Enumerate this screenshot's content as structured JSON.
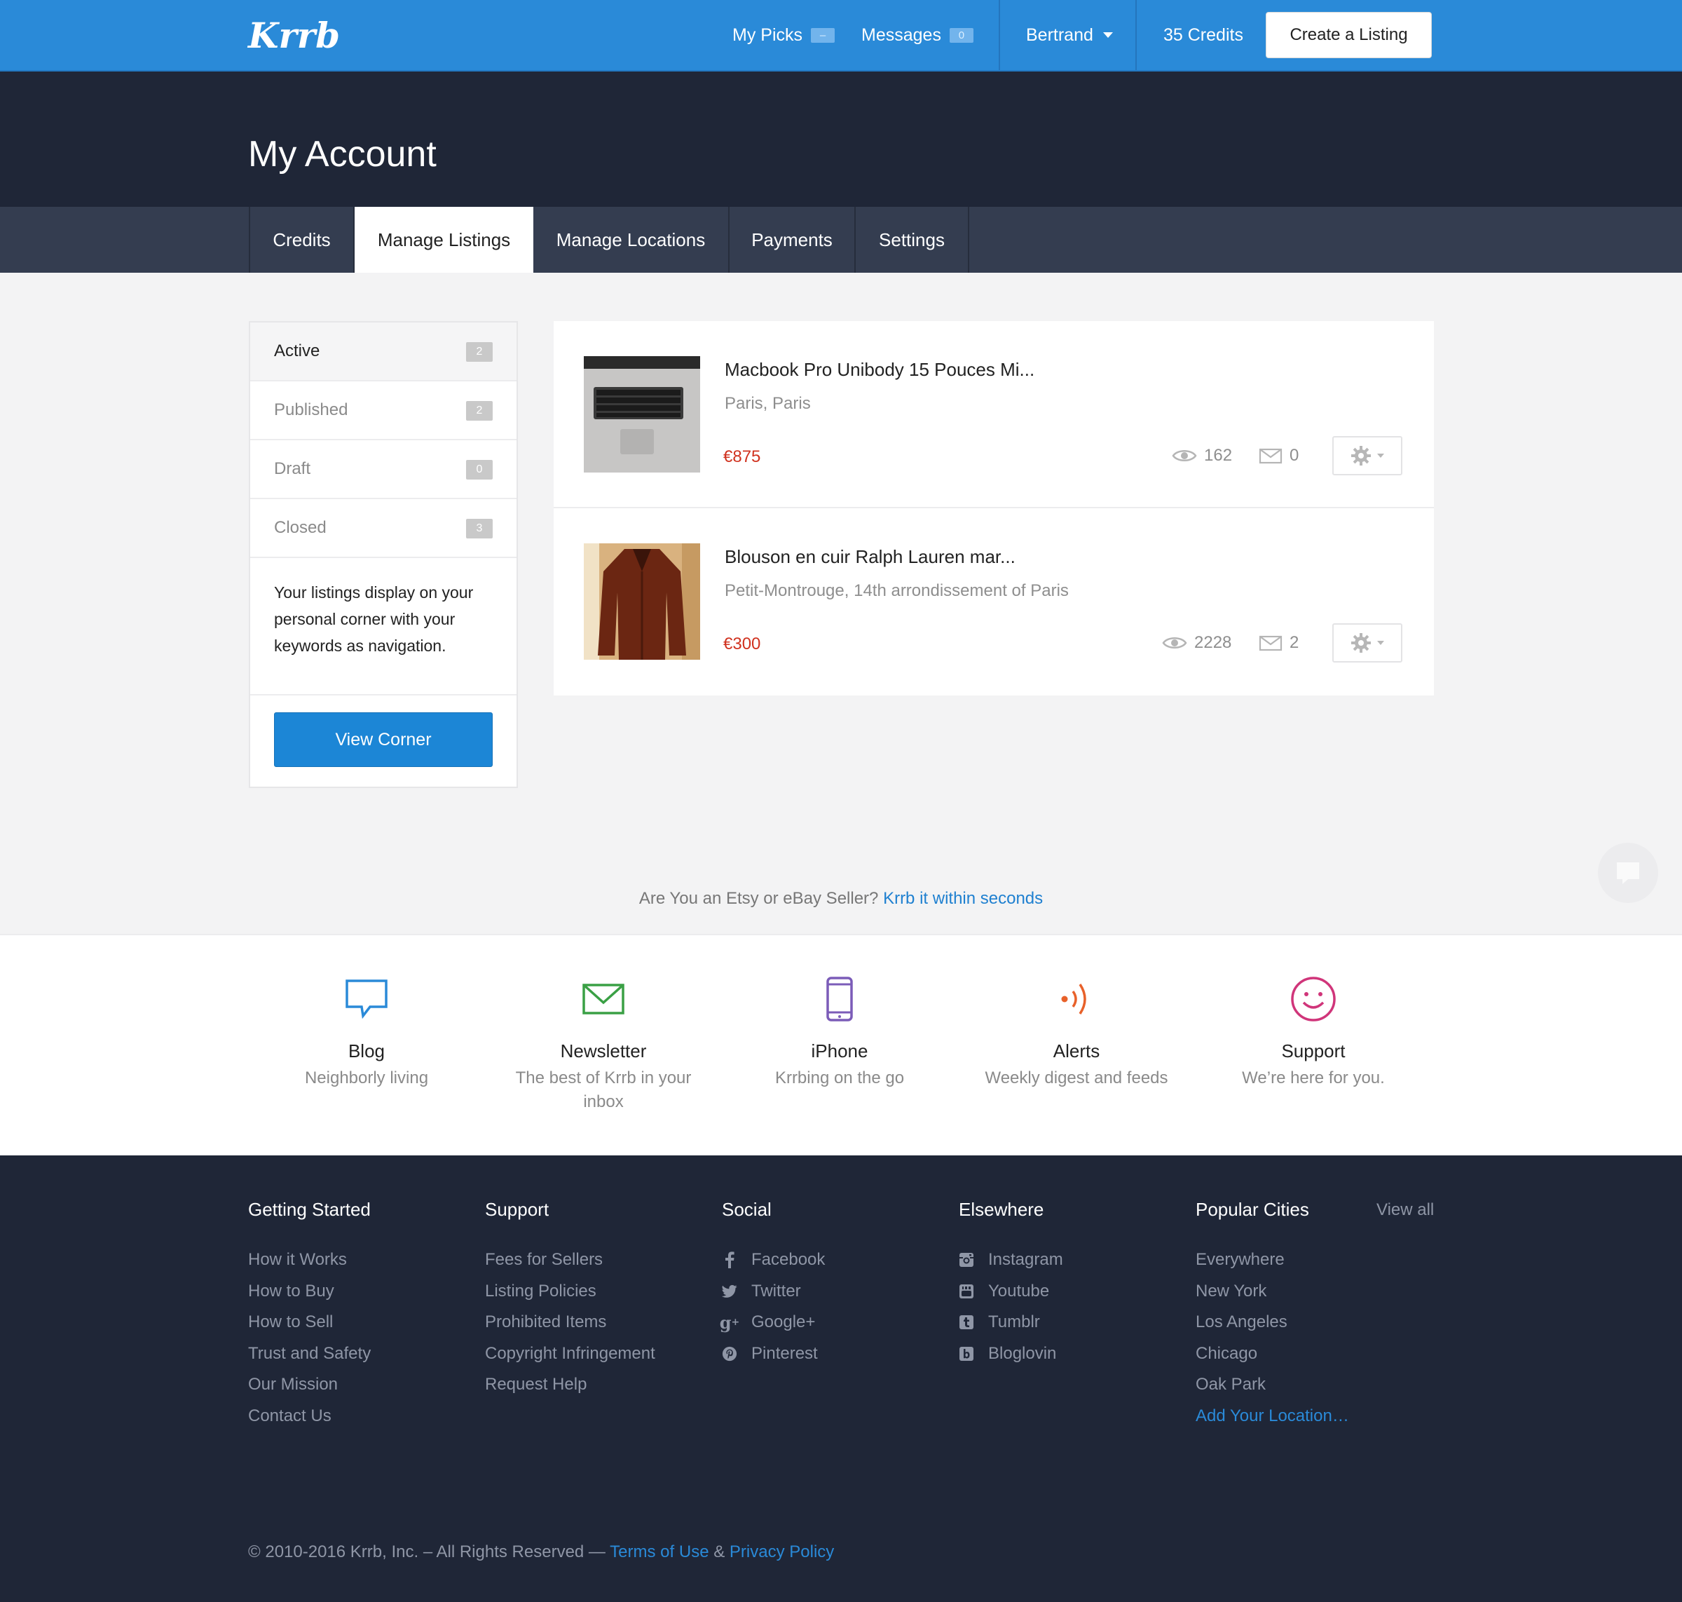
{
  "brand": {
    "logo_text": "Krrb"
  },
  "topnav": {
    "my_picks": "My Picks",
    "my_picks_badge": "–",
    "messages": "Messages",
    "messages_badge": "0",
    "user": "Bertrand",
    "credits": "35 Credits",
    "create_listing": "Create a Listing"
  },
  "page": {
    "title": "My Account"
  },
  "tabs": [
    {
      "label": "Credits"
    },
    {
      "label": "Manage Listings",
      "active": true
    },
    {
      "label": "Manage Locations"
    },
    {
      "label": "Payments"
    },
    {
      "label": "Settings"
    }
  ],
  "sidebar": {
    "items": [
      {
        "label": "Active",
        "count": "2",
        "active": true
      },
      {
        "label": "Published",
        "count": "2"
      },
      {
        "label": "Draft",
        "count": "0"
      },
      {
        "label": "Closed",
        "count": "3"
      }
    ],
    "description": "Your listings display on your personal corner with your keywords as navigation.",
    "view_corner": "View Corner"
  },
  "listings": [
    {
      "title": "Macbook Pro Unibody 15 Pouces Mi...",
      "location": "Paris, Paris",
      "price": "€875",
      "views": "162",
      "messages": "0"
    },
    {
      "title": "Blouson en cuir Ralph Lauren mar...",
      "location": "Petit-Montrouge, 14th arrondissement of Paris",
      "price": "€300",
      "views": "2228",
      "messages": "2"
    }
  ],
  "promo": {
    "text": "Are You an Etsy or eBay Seller?",
    "link": "Krrb it within seconds"
  },
  "features": [
    {
      "title": "Blog",
      "sub": "Neighborly living",
      "icon": "speech-bubble-icon",
      "color": "#2a8ad8"
    },
    {
      "title": "Newsletter",
      "sub": "The best of Krrb in your inbox",
      "icon": "envelope-icon",
      "color": "#3aa045"
    },
    {
      "title": "iPhone",
      "sub": "Krrbing on the go",
      "icon": "phone-icon",
      "color": "#7b5cb8"
    },
    {
      "title": "Alerts",
      "sub": "Weekly digest and feeds",
      "icon": "signal-icon",
      "color": "#e8612a"
    },
    {
      "title": "Support",
      "sub": "We’re here for you.",
      "icon": "smiley-icon",
      "color": "#d0357a"
    }
  ],
  "footer": {
    "getting_started": {
      "heading": "Getting Started",
      "links": [
        "How it Works",
        "How to Buy",
        "How to Sell",
        "Trust and Safety",
        "Our Mission",
        "Contact Us"
      ]
    },
    "support": {
      "heading": "Support",
      "links": [
        "Fees for Sellers",
        "Listing Policies",
        "Prohibited Items",
        "Copyright Infringement",
        "Request Help"
      ]
    },
    "social": {
      "heading": "Social",
      "links": [
        {
          "label": "Facebook",
          "icon": "facebook-icon"
        },
        {
          "label": "Twitter",
          "icon": "twitter-icon"
        },
        {
          "label": "Google+",
          "icon": "google-plus-icon"
        },
        {
          "label": "Pinterest",
          "icon": "pinterest-icon"
        }
      ]
    },
    "elsewhere": {
      "heading": "Elsewhere",
      "links": [
        {
          "label": "Instagram",
          "icon": "instagram-icon"
        },
        {
          "label": "Youtube",
          "icon": "youtube-icon"
        },
        {
          "label": "Tumblr",
          "icon": "tumblr-icon"
        },
        {
          "label": "Bloglovin",
          "icon": "bloglovin-icon"
        }
      ]
    },
    "cities": {
      "heading": "Popular Cities",
      "view_all": "View all",
      "links": [
        "Everywhere",
        "New York",
        "Los Angeles",
        "Chicago",
        "Oak Park"
      ],
      "add": "Add Your Location…"
    },
    "copyright": "© 2010-2016 Krrb, Inc. – All Rights Reserved —",
    "terms": "Terms of Use",
    "amp": "&",
    "privacy": "Privacy Policy"
  },
  "colors": {
    "brand_blue": "#2a8ad8",
    "dark_navy": "#1f2637",
    "tab_bar": "#343d50",
    "price_red": "#d0321f"
  }
}
